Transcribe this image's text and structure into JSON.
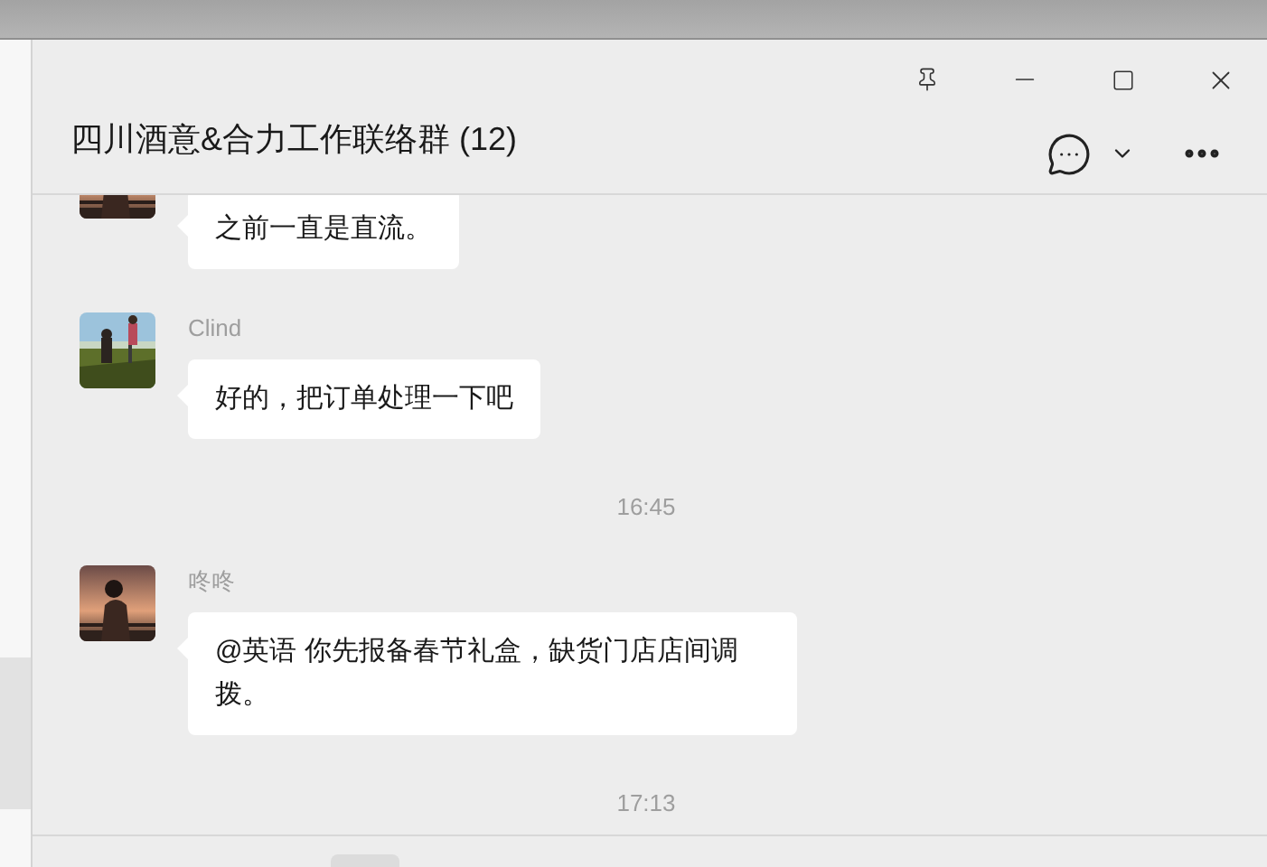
{
  "window": {
    "title": "四川酒意&合力工作联络群 (12)"
  },
  "messages": [
    {
      "kind": "message",
      "text": "之前一直是直流。"
    },
    {
      "kind": "message",
      "sender": "Clind",
      "text": "好的，把订单处理一下吧"
    },
    {
      "kind": "time",
      "text": "16:45"
    },
    {
      "kind": "message",
      "sender": "咚咚",
      "text": "@英语 你先报备春节礼盒，缺货门店店间调拨。"
    },
    {
      "kind": "time",
      "text": "17:13"
    }
  ]
}
